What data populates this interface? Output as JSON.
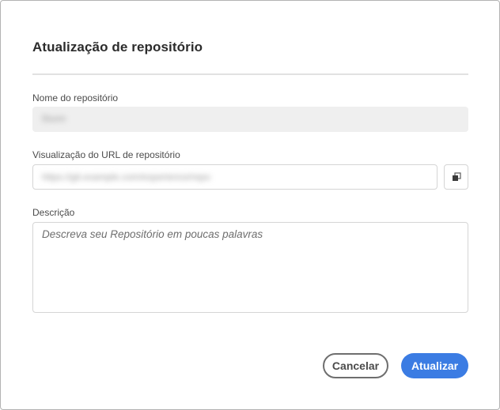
{
  "dialog": {
    "title": "Atualização de repositório"
  },
  "fields": {
    "name_label": "Nome do repositório",
    "name_value": "Stunn",
    "url_label": "Visualização do URL de repositório",
    "url_value": "https://git.example.com/experience/repo",
    "description_label": "Descrição",
    "description_placeholder": "Descreva seu Repositório em poucas palavras"
  },
  "icons": {
    "copy": "copy-icon"
  },
  "actions": {
    "cancel_label": "Cancelar",
    "submit_label": "Atualizar"
  },
  "colors": {
    "primary": "#3b7ce3",
    "disabled_field": "#efefef",
    "border": "#d5d5d5"
  }
}
